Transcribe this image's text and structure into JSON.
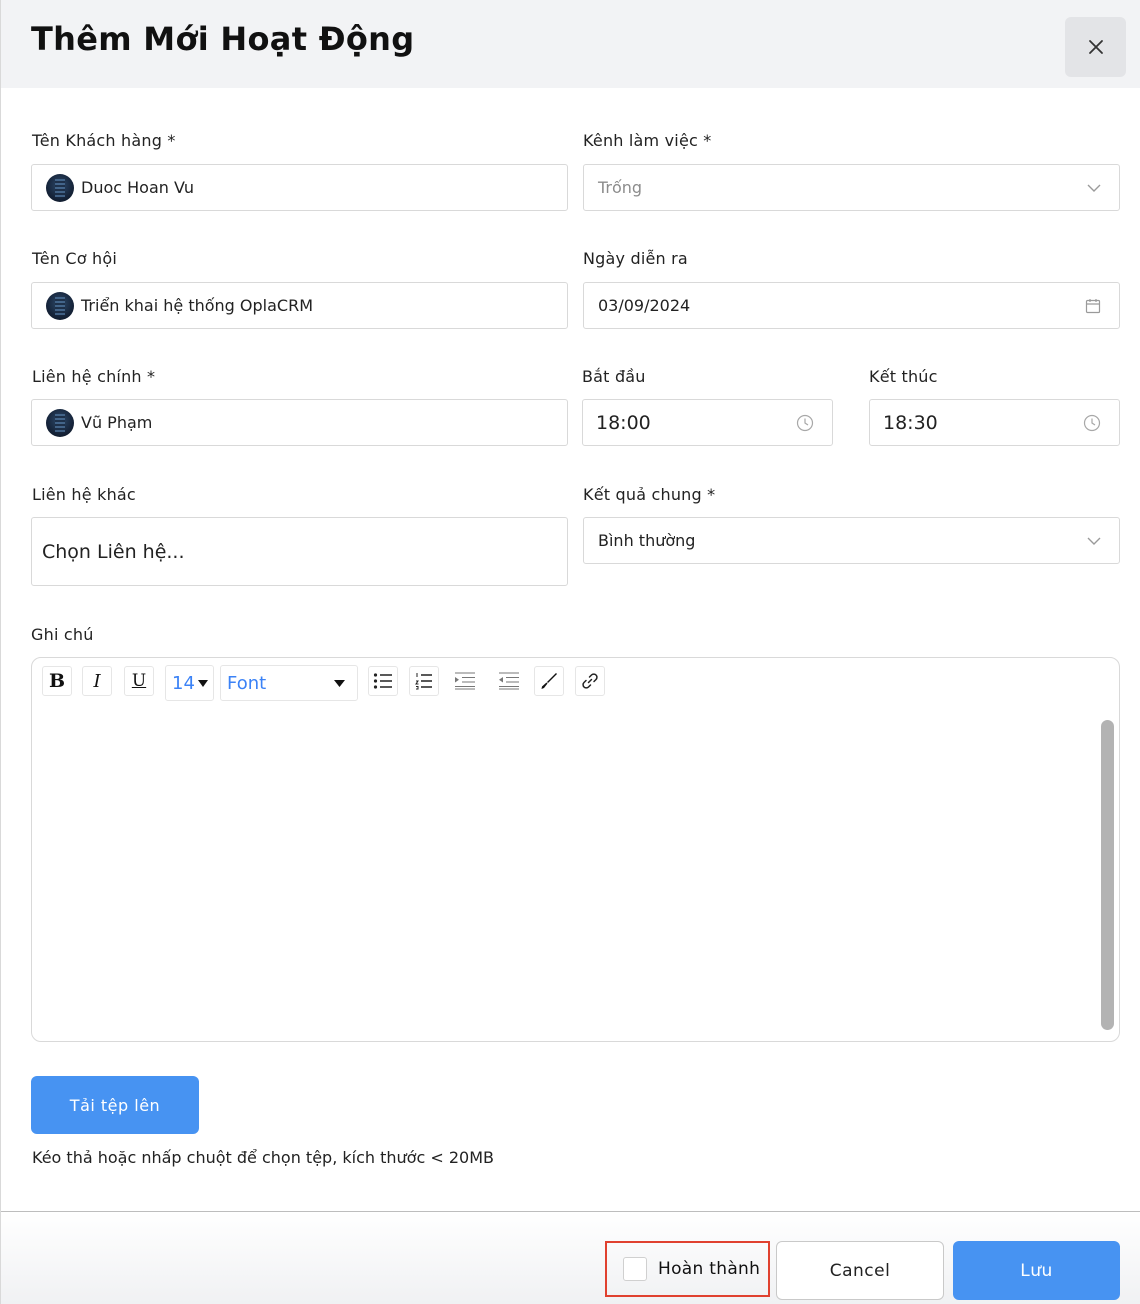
{
  "dialog": {
    "title": "Thêm Mới Hoạt Động",
    "close_label": "×"
  },
  "form": {
    "customer": {
      "label": "Tên Khách hàng *",
      "value": "Duoc Hoan Vu"
    },
    "channel": {
      "label": "Kênh làm việc *",
      "placeholder": "Trống"
    },
    "opportunity": {
      "label": "Tên Cơ hội",
      "value": "Triển khai hệ thống OplaCRM"
    },
    "date": {
      "label": "Ngày diễn ra",
      "value": "03/09/2024"
    },
    "main_contact": {
      "label": "Liên hệ chính *",
      "value": "Vũ Phạm"
    },
    "start": {
      "label": "Bắt đầu",
      "value": "18:00"
    },
    "end": {
      "label": "Kết thúc",
      "value": "18:30"
    },
    "other_contact": {
      "label": "Liên hệ khác",
      "placeholder": "Chọn Liên hệ..."
    },
    "result": {
      "label": "Kết quả chung *",
      "value": "Bình thường"
    },
    "note": {
      "label": "Ghi chú"
    }
  },
  "editor": {
    "toolbar": {
      "bold": "B",
      "italic": "I",
      "underline": "U",
      "font_size": "14",
      "font_family": "Font"
    }
  },
  "upload": {
    "button_label": "Tải tệp lên",
    "hint": "Kéo thả hoặc nhấp chuột để chọn tệp, kích thước < 20MB"
  },
  "footer": {
    "done_label": "Hoàn thành",
    "cancel_label": "Cancel",
    "save_label": "Lưu"
  },
  "colors": {
    "primary": "#4793f2",
    "highlight_border": "#e0412f",
    "header_bg": "#f2f3f5"
  },
  "icons": {
    "close": "close-icon",
    "chevron": "chevron-down-icon",
    "calendar": "calendar-icon",
    "clock": "clock-icon",
    "avatar": "avatar"
  }
}
